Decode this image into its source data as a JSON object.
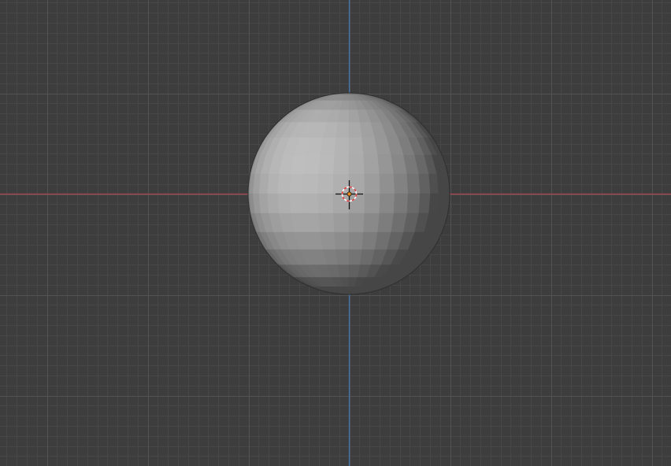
{
  "viewport": {
    "view": "front-orthographic",
    "background_color": "#3d3d3d",
    "grid": {
      "minor_line_color": "#474747",
      "major_line_color": "#535353"
    },
    "axes": {
      "x_axis_color": "#a8434f",
      "z_axis_color": "#3f74ad"
    },
    "object": {
      "type": "uv-sphere",
      "shading": "solid",
      "base_color": "#a3a3a3",
      "origin_color": "#f08a1a"
    },
    "cursor_3d": {
      "ring_color_a": "#e23c3c",
      "ring_color_b": "#ffffff"
    }
  }
}
